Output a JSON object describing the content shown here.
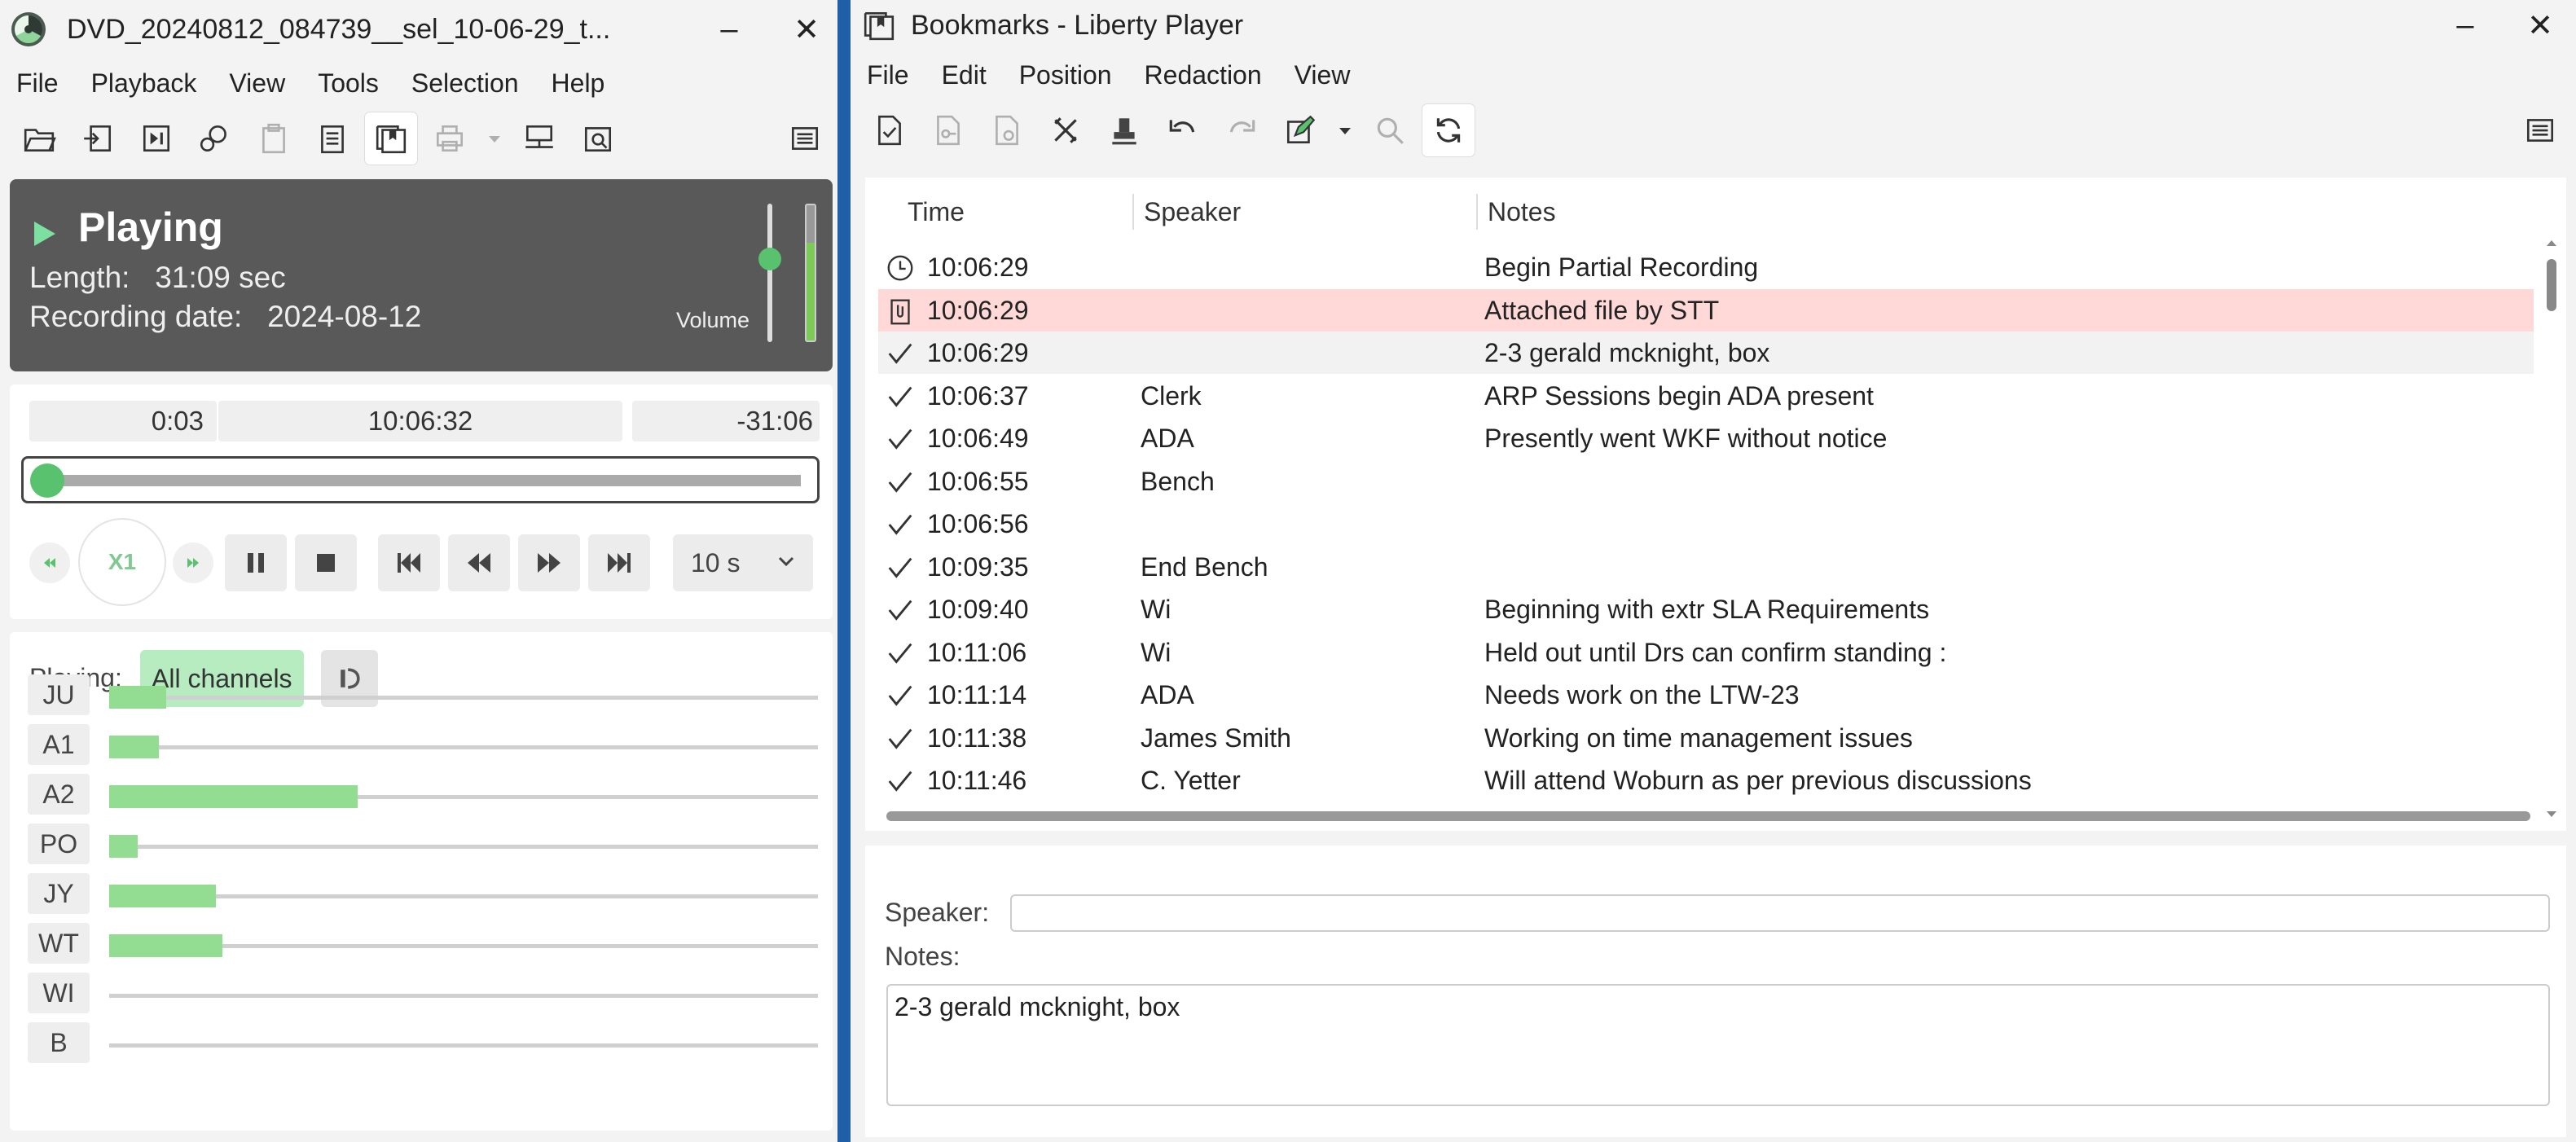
{
  "player": {
    "title": "DVD_20240812_084739__sel_10-06-29_t...",
    "menu": [
      "File",
      "Playback",
      "View",
      "Tools",
      "Selection",
      "Help"
    ],
    "status": {
      "state": "Playing",
      "length_label": "Length:",
      "length_value": "31:09 sec",
      "date_label": "Recording date:",
      "date_value": "2024-08-12",
      "volume_label": "Volume",
      "volume_level": 0.62,
      "meter_level": 0.72
    },
    "transport": {
      "elapsed": "0:03",
      "clock": "10:06:32",
      "remaining": "-31:06",
      "position_fraction": 0.0,
      "speed": "X1",
      "skip": "10 s"
    },
    "channels": {
      "playing_label": "Playing:",
      "all_label": "All channels",
      "items": [
        {
          "name": "JU",
          "level": 0.08
        },
        {
          "name": "A1",
          "level": 0.07
        },
        {
          "name": "A2",
          "level": 0.35
        },
        {
          "name": "PO",
          "level": 0.04
        },
        {
          "name": "JY",
          "level": 0.15
        },
        {
          "name": "WT",
          "level": 0.16
        },
        {
          "name": "WI",
          "level": 0.0
        },
        {
          "name": "B",
          "level": 0.0
        }
      ]
    },
    "accent": "#58c26e"
  },
  "bookmarks": {
    "title": "Bookmarks - Liberty Player",
    "menu": [
      "File",
      "Edit",
      "Position",
      "Redaction",
      "View"
    ],
    "columns": {
      "time": "Time",
      "speaker": "Speaker",
      "notes": "Notes"
    },
    "rows": [
      {
        "icon": "clock-icon",
        "time": "10:06:29",
        "speaker": "",
        "notes": "Begin Partial Recording"
      },
      {
        "icon": "attachment-icon",
        "time": "10:06:29",
        "speaker": "",
        "notes": "Attached file by STT"
      },
      {
        "icon": "check-icon",
        "time": "10:06:29",
        "speaker": "",
        "notes": "2-3 gerald mcknight, box"
      },
      {
        "icon": "check-icon",
        "time": "10:06:37",
        "speaker": "Clerk",
        "notes": "ARP Sessions begin ADA present"
      },
      {
        "icon": "check-icon",
        "time": "10:06:49",
        "speaker": "ADA",
        "notes": "Presently went WKF without notice"
      },
      {
        "icon": "check-icon",
        "time": "10:06:55",
        "speaker": "Bench",
        "notes": ""
      },
      {
        "icon": "check-icon",
        "time": "10:06:56",
        "speaker": "",
        "notes": ""
      },
      {
        "icon": "check-icon",
        "time": "10:09:35",
        "speaker": "End Bench",
        "notes": ""
      },
      {
        "icon": "check-icon",
        "time": "10:09:40",
        "speaker": "Wi",
        "notes": "Beginning with extr SLA Requirements"
      },
      {
        "icon": "check-icon",
        "time": "10:11:06",
        "speaker": "Wi",
        "notes": "Held out until Drs can confirm standing :"
      },
      {
        "icon": "check-icon",
        "time": "10:11:14",
        "speaker": "ADA",
        "notes": "Needs work on the LTW-23"
      },
      {
        "icon": "check-icon",
        "time": "10:11:38",
        "speaker": "James Smith",
        "notes": "Working on time management issues"
      },
      {
        "icon": "check-icon",
        "time": "10:11:46",
        "speaker": "C. Yetter",
        "notes": "Will attend Woburn as per previous discussions"
      }
    ],
    "edit": {
      "speaker_label": "Speaker:",
      "speaker_value": "",
      "notes_label": "Notes:",
      "notes_value": "2-3 gerald mcknight, box"
    },
    "highlight_color": "#ffd8d8"
  }
}
